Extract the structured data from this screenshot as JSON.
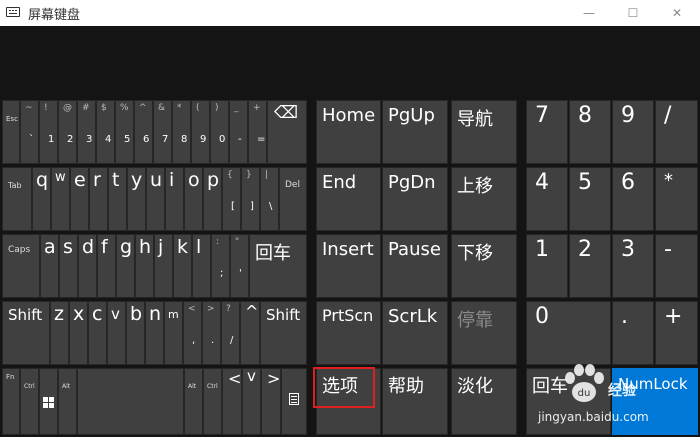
{
  "window": {
    "title": "屏幕键盘",
    "minimize_glyph": "—",
    "maximize_glyph": "☐",
    "close_glyph": "✕"
  },
  "rows": {
    "row1": [
      {
        "id": "esc",
        "label": "Esc"
      },
      {
        "id": "tilde",
        "top": "~",
        "bottom": "`"
      },
      {
        "id": "k1",
        "top": "!",
        "bottom": "1"
      },
      {
        "id": "k2",
        "top": "@",
        "bottom": "2"
      },
      {
        "id": "k3",
        "top": "#",
        "bottom": "3"
      },
      {
        "id": "k4",
        "top": "$",
        "bottom": "4"
      },
      {
        "id": "k5",
        "top": "%",
        "bottom": "5"
      },
      {
        "id": "k6",
        "top": "^",
        "bottom": "6"
      },
      {
        "id": "k7",
        "top": "&",
        "bottom": "7"
      },
      {
        "id": "k8",
        "top": "*",
        "bottom": "8"
      },
      {
        "id": "k9",
        "top": "(",
        "bottom": "9"
      },
      {
        "id": "k0",
        "top": ")",
        "bottom": "0"
      },
      {
        "id": "minus",
        "top": "_",
        "bottom": "-"
      },
      {
        "id": "equal",
        "top": "+",
        "bottom": "="
      },
      {
        "id": "backspace",
        "label": "⌫"
      }
    ],
    "row2": [
      {
        "id": "tab",
        "label": "Tab"
      },
      {
        "id": "q",
        "letter": "q"
      },
      {
        "id": "w",
        "letter": "w"
      },
      {
        "id": "e",
        "letter": "e"
      },
      {
        "id": "r",
        "letter": "r"
      },
      {
        "id": "t",
        "letter": "t"
      },
      {
        "id": "y",
        "letter": "y"
      },
      {
        "id": "u",
        "letter": "u"
      },
      {
        "id": "i",
        "letter": "i"
      },
      {
        "id": "o",
        "letter": "o"
      },
      {
        "id": "p",
        "letter": "p"
      },
      {
        "id": "lbracket",
        "top": "{",
        "bottom": "["
      },
      {
        "id": "rbracket",
        "top": "}",
        "bottom": "]"
      },
      {
        "id": "backslash",
        "top": "|",
        "bottom": "\\"
      },
      {
        "id": "del",
        "label": "Del"
      }
    ],
    "row3": [
      {
        "id": "caps",
        "label": "Caps"
      },
      {
        "id": "a",
        "letter": "a"
      },
      {
        "id": "s",
        "letter": "s"
      },
      {
        "id": "d",
        "letter": "d"
      },
      {
        "id": "f",
        "letter": "f"
      },
      {
        "id": "g",
        "letter": "g"
      },
      {
        "id": "h",
        "letter": "h"
      },
      {
        "id": "j",
        "letter": "j"
      },
      {
        "id": "k",
        "letter": "k"
      },
      {
        "id": "l",
        "letter": "l"
      },
      {
        "id": "semicolon",
        "top": ":",
        "bottom": ";"
      },
      {
        "id": "quote",
        "top": "\"",
        "bottom": "'"
      },
      {
        "id": "enter",
        "label": "回车"
      }
    ],
    "row4": [
      {
        "id": "shift_l",
        "label": "Shift"
      },
      {
        "id": "z",
        "letter": "z"
      },
      {
        "id": "x",
        "letter": "x"
      },
      {
        "id": "c",
        "letter": "c"
      },
      {
        "id": "v",
        "letter": "v"
      },
      {
        "id": "b",
        "letter": "b"
      },
      {
        "id": "n",
        "letter": "n"
      },
      {
        "id": "m",
        "letter": "m"
      },
      {
        "id": "comma",
        "top": "<",
        "bottom": ","
      },
      {
        "id": "period",
        "top": ">",
        "bottom": "."
      },
      {
        "id": "slash",
        "top": "?",
        "bottom": "/"
      },
      {
        "id": "up",
        "label": "^"
      },
      {
        "id": "shift_r",
        "label": "Shift"
      }
    ],
    "row5": [
      {
        "id": "fn",
        "label": "Fn"
      },
      {
        "id": "ctrl_l",
        "label": "Ctrl"
      },
      {
        "id": "win",
        "label": "win-logo-icon"
      },
      {
        "id": "alt_l",
        "label": "Alt"
      },
      {
        "id": "space",
        "label": ""
      },
      {
        "id": "alt_r",
        "label": "Alt"
      },
      {
        "id": "ctrl_r",
        "label": "Ctrl"
      },
      {
        "id": "left",
        "label": "<"
      },
      {
        "id": "down",
        "label": "v"
      },
      {
        "id": "right",
        "label": ">"
      },
      {
        "id": "menu",
        "label": "menu-icon"
      }
    ]
  },
  "nav": {
    "home": "Home",
    "pgup": "PgUp",
    "navigate": "导航",
    "end": "End",
    "pgdn": "PgDn",
    "moveup": "上移",
    "insert": "Insert",
    "pause": "Pause",
    "movedown": "下移",
    "prtscn": "PrtScn",
    "scrlk": "ScrLk",
    "dock": "停靠",
    "options": "选项",
    "help": "帮助",
    "fade": "淡化"
  },
  "numpad": {
    "n7": "7",
    "n8": "8",
    "n9": "9",
    "div": "/",
    "n4": "4",
    "n5": "5",
    "n6": "6",
    "mul": "*",
    "n1": "1",
    "n2": "2",
    "n3": "3",
    "sub": "-",
    "n0": "0",
    "dot": ".",
    "add": "+",
    "enter": "回车",
    "numlock": "NumLock"
  },
  "colors": {
    "key_bg": "#404040",
    "board_bg": "#141414",
    "accent": "#0078d7",
    "highlight": "#e02020"
  },
  "watermark": {
    "text": "经验",
    "url": "jingyan.baidu.com"
  }
}
